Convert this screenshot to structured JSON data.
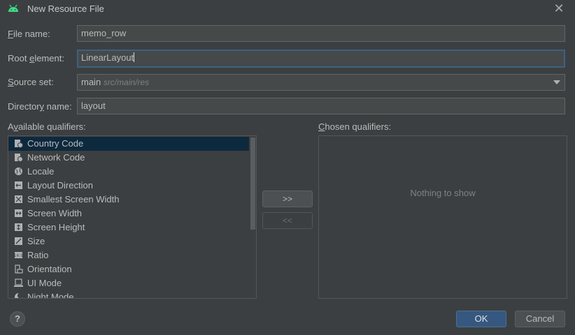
{
  "window": {
    "title": "New Resource File",
    "close_glyph": "✕"
  },
  "form": {
    "file_name_label": "File name:",
    "file_name_value": "memo_row",
    "root_element_label": "Root element:",
    "root_element_value": "LinearLayout",
    "source_set_label": "Source set:",
    "source_set_value": "main",
    "source_set_path": "src/main/res",
    "directory_name_label": "Directory name:",
    "directory_name_value": "layout"
  },
  "qualifiers": {
    "available_label": "Available qualifiers:",
    "chosen_label": "Chosen qualifiers:",
    "chosen_empty_text": "Nothing to show",
    "add_button": ">>",
    "remove_button": "<<",
    "items": [
      {
        "label": "Country Code",
        "icon": "country-code-icon",
        "selected": true
      },
      {
        "label": "Network Code",
        "icon": "network-code-icon"
      },
      {
        "label": "Locale",
        "icon": "globe-icon"
      },
      {
        "label": "Layout Direction",
        "icon": "layout-direction-icon"
      },
      {
        "label": "Smallest Screen Width",
        "icon": "smallest-screen-width-icon"
      },
      {
        "label": "Screen Width",
        "icon": "screen-width-icon"
      },
      {
        "label": "Screen Height",
        "icon": "screen-height-icon"
      },
      {
        "label": "Size",
        "icon": "size-icon"
      },
      {
        "label": "Ratio",
        "icon": "ratio-icon"
      },
      {
        "label": "Orientation",
        "icon": "orientation-icon"
      },
      {
        "label": "UI Mode",
        "icon": "ui-mode-icon"
      },
      {
        "label": "Night Mode",
        "icon": "night-mode-icon"
      }
    ]
  },
  "footer": {
    "help": "?",
    "ok": "OK",
    "cancel": "Cancel"
  },
  "colors": {
    "background": "#3c3f41",
    "accent": "#365880",
    "focus_border": "#3d6185",
    "selection": "#0d293e",
    "logo": "#3ddc84"
  }
}
